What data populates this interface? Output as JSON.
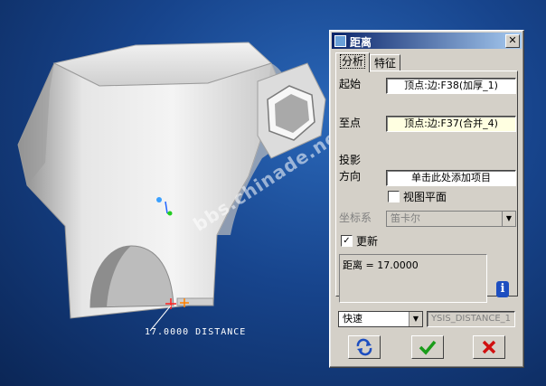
{
  "viewport": {
    "watermark": "bbs.chinade.net",
    "measurement_label": "17.0000  DISTANCE"
  },
  "dialog": {
    "title": "距离",
    "close_glyph": "✕",
    "tabs": [
      {
        "label": "分析"
      },
      {
        "label": "特征"
      }
    ],
    "from_label": "起始",
    "from_value": "顶点:边:F38(加厚_1)",
    "to_label": "至点",
    "to_value": "顶点:边:F37(合并_4)",
    "projection_label": "投影",
    "direction_label": "方向",
    "direction_value": "单击此处添加项目",
    "view_plane_label": "视图平面",
    "view_plane_checked": false,
    "coord_label": "坐标系",
    "coord_value": "笛卡尔",
    "update_label": "更新",
    "update_checked": true,
    "result_text": "距离 = 17.0000",
    "info_glyph": "i",
    "mode_value": "快速",
    "name_value": "YSIS_DISTANCE_1",
    "buttons": {
      "repeat_icon": "repeat-icon",
      "ok_icon": "check-icon",
      "cancel_icon": "cross-icon"
    },
    "colors": {
      "title_bar": "#0a246a",
      "ok_green": "#1a9c1a",
      "cancel_red": "#d01010",
      "repeat_blue": "#1d4ec0"
    }
  }
}
